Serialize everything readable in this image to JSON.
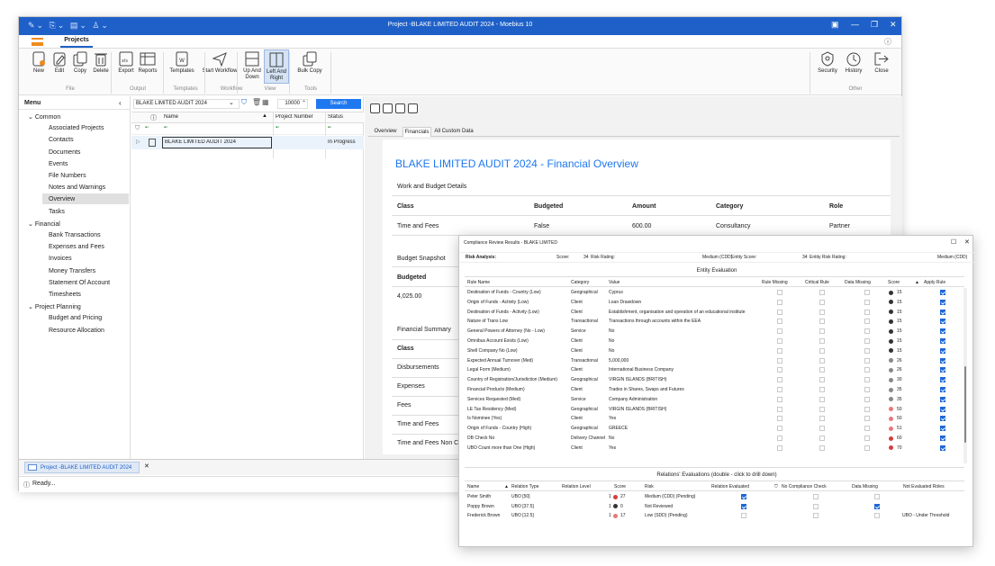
{
  "window": {
    "title": "Project -BLAKE LIMITED AUDIT 2024 - Moebius 10",
    "tab": "Projects"
  },
  "ribbon": {
    "buttons": [
      {
        "id": "new",
        "label": "New"
      },
      {
        "id": "edit",
        "label": "Edit"
      },
      {
        "id": "copy",
        "label": "Copy"
      },
      {
        "id": "delete",
        "label": "Delete"
      },
      {
        "id": "export",
        "label": "Export"
      },
      {
        "id": "reports",
        "label": "Reports"
      },
      {
        "id": "templates",
        "label": "Templates"
      },
      {
        "id": "startwf",
        "label": "Start Workflow"
      },
      {
        "id": "updown",
        "label": "Up And Down"
      },
      {
        "id": "leftright",
        "label": "Left And Right"
      },
      {
        "id": "bulkcopy",
        "label": "Bulk Copy"
      },
      {
        "id": "security",
        "label": "Security"
      },
      {
        "id": "history",
        "label": "History"
      },
      {
        "id": "close",
        "label": "Close"
      }
    ],
    "groups": [
      "File",
      "Output",
      "Templates",
      "Workflow",
      "View",
      "Tools",
      "Other"
    ]
  },
  "sidebar": {
    "title": "Menu",
    "groups": [
      {
        "label": "Common",
        "items": [
          "Associated Projects",
          "Contacts",
          "Documents",
          "Events",
          "File Numbers",
          "Notes and Warnings",
          "Overview",
          "Tasks"
        ]
      },
      {
        "label": "Financial",
        "items": [
          "Bank Transactions",
          "Expenses and Fees",
          "Invoices",
          "Money Transfers",
          "Statement Of Account",
          "Timesheets"
        ]
      },
      {
        "label": "Project Planning",
        "items": [
          "Budget and Pricing",
          "Resource Allocation"
        ]
      }
    ],
    "selected": "Overview"
  },
  "grid": {
    "search_value": "BLAKE LIMITED AUDIT 2024",
    "count": "10000",
    "search_label": "Search",
    "columns": [
      "Name",
      "Project Number",
      "Status"
    ],
    "rows": [
      {
        "name": "BLAKE LIMITED AUDIT 2024",
        "number": "",
        "status": "In Progress"
      }
    ]
  },
  "financial": {
    "tabs": [
      "Overview",
      "Financials",
      "All Custom Data"
    ],
    "active_tab": "Financials",
    "title": "BLAKE LIMITED AUDIT 2024 - Financial Overview",
    "section1": "Work and Budget Details",
    "headers": [
      "Class",
      "Budgeted",
      "Amount",
      "Category",
      "Role"
    ],
    "row": [
      "Time and Fees",
      "False",
      "600.00",
      "Consultancy",
      "Partner"
    ],
    "section2": "Budget Snapshot",
    "budgeted_label": "Budgeted",
    "budgeted_value": "4,025.00",
    "section3": "Financial Summary",
    "summary_rows": [
      "Class",
      "Disbursements",
      "Expenses",
      "Fees",
      "Time and Fees",
      "Time and Fees Non Chargeabl"
    ]
  },
  "taskbar": {
    "item": "Project -BLAKE LIMITED AUDIT 2024"
  },
  "status": {
    "text": "Ready..."
  },
  "dialog": {
    "title": "Compliance Review Results - BLAKE LIMITED",
    "risk_analysis_label": "Risk Analysis:",
    "score_label": "Score:",
    "score": "34",
    "risk_rating_label": "Risk Rating:",
    "risk_rating": "Medium (CDD)",
    "entity_score_label": "Entity Score:",
    "entity_score": "34",
    "entity_rating_label": "Entity Risk Rating:",
    "entity_rating": "Medium (CDD)",
    "entity_title": "Entity Evaluation",
    "entity_columns": [
      "Rule Name",
      "Category",
      "Value",
      "Rule Missing",
      "Critical Rule",
      "Data Missing",
      "Score",
      "Apply Rule"
    ],
    "entity_rows": [
      {
        "rule": "Destination of Funds - Country (Low)",
        "cat": "Geographical",
        "val": "Cyprus",
        "score": "15",
        "color": "#333333"
      },
      {
        "rule": "Origin of Funds - Activity (Low)",
        "cat": "Client",
        "val": "Loan Drawdown",
        "score": "15",
        "color": "#333333"
      },
      {
        "rule": "Destination of Funds - Activity (Low)",
        "cat": "Client",
        "val": "Establishment, organisation and operation of an educational institute",
        "score": "15",
        "color": "#333333"
      },
      {
        "rule": "Nature of Trans Low",
        "cat": "Transactional",
        "val": "Transactions through accounts within the EEA",
        "score": "15",
        "color": "#333333"
      },
      {
        "rule": "General Powers of Attorney (No - Low)",
        "cat": "Service",
        "val": "No",
        "score": "15",
        "color": "#333333"
      },
      {
        "rule": "Omnibus Account Exists (Low)",
        "cat": "Client",
        "val": "No",
        "score": "15",
        "color": "#333333"
      },
      {
        "rule": "Shell Company No (Low)",
        "cat": "Client",
        "val": "No",
        "score": "15",
        "color": "#333333"
      },
      {
        "rule": "Expected Annual Turnover (Med)",
        "cat": "Transactional",
        "val": "5,000,000",
        "score": "26",
        "color": "#888888"
      },
      {
        "rule": "Legal Form (Medium)",
        "cat": "Client",
        "val": "International Business Company",
        "score": "26",
        "color": "#888888"
      },
      {
        "rule": "Country of Registration/Jurisdiction (Medium)",
        "cat": "Geographical",
        "val": "VIRGIN ISLANDS (BRITISH)",
        "score": "30",
        "color": "#888888"
      },
      {
        "rule": "Financial Products (Medium)",
        "cat": "Client",
        "val": "Trades in Shares, Swaps and Futures",
        "score": "35",
        "color": "#888888"
      },
      {
        "rule": "Services Requested (Med)",
        "cat": "Service",
        "val": "Company Administration",
        "score": "35",
        "color": "#888888"
      },
      {
        "rule": "LE Tax Residency (Med)",
        "cat": "Geographical",
        "val": "VIRGIN ISLANDS (BRITISH)",
        "score": "50",
        "color": "#e87878"
      },
      {
        "rule": "Is Nominee (Yes)",
        "cat": "Client",
        "val": "Yes",
        "score": "50",
        "color": "#e87878"
      },
      {
        "rule": "Origin of Funds - Country (High)",
        "cat": "Geographical",
        "val": "GREECE",
        "score": "51",
        "color": "#e87878"
      },
      {
        "rule": "DB Check No",
        "cat": "Delivery Channel",
        "val": "No",
        "score": "60",
        "color": "#d43c3c"
      },
      {
        "rule": "UBO Count more than One (High)",
        "cat": "Client",
        "val": "Yes",
        "score": "70",
        "color": "#d43c3c"
      }
    ],
    "relations_title": "Relations' Evaluations (double - click to drill down)",
    "rel_columns": [
      "Name",
      "Relation Type",
      "Relation Level",
      "Score",
      "Risk",
      "Relation Evaluated",
      "No Compliance Check",
      "Data Missing",
      "Not Evaluated Roles"
    ],
    "rel_rows": [
      {
        "name": "Peter Smith",
        "type": "UBO [50]",
        "level": "1",
        "score": "27",
        "color": "#d43c3c",
        "risk": "Medium (CDD) (Pending)",
        "evaluated": true,
        "nocheck": false,
        "missing": false,
        "roles": ""
      },
      {
        "name": "Poppy Brown",
        "type": "UBO [37.5]",
        "level": "1",
        "score": "0",
        "color": "#333333",
        "risk": "Not Reviewed",
        "evaluated": true,
        "nocheck": false,
        "missing": true,
        "roles": ""
      },
      {
        "name": "Frederick Brown",
        "type": "UBO [12.5]",
        "level": "1",
        "score": "17",
        "color": "#e87878",
        "risk": "Low (SDD) (Pending)",
        "evaluated": false,
        "nocheck": false,
        "missing": false,
        "roles": "UBO - Under Threshold"
      }
    ]
  }
}
